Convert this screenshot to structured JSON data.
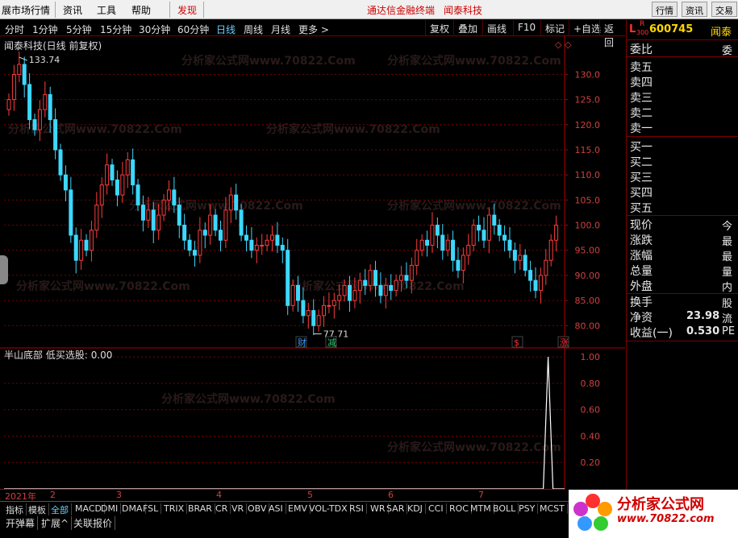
{
  "menubar": {
    "items": [
      {
        "label": "展市场行情",
        "color": "#000"
      },
      {
        "label": "资讯",
        "color": "#000"
      },
      {
        "label": "工具",
        "color": "#000"
      },
      {
        "label": "帮助",
        "color": "#000"
      },
      {
        "label": "发现",
        "color": "#d00000"
      }
    ],
    "center_brand": "通达信金融终端",
    "center_stock": "闻泰科技",
    "right_buttons": [
      "行情",
      "资讯",
      "交易"
    ]
  },
  "toolbar": {
    "periods": [
      "分时",
      "1分钟",
      "5分钟",
      "15分钟",
      "30分钟",
      "60分钟",
      "日线",
      "周线",
      "月线",
      "更多 >"
    ],
    "active_period": "日线",
    "buttons": [
      "复权",
      "叠加",
      "画线",
      "F10",
      "标记",
      "+自选",
      "返回"
    ]
  },
  "chart": {
    "title": "闻泰科技(日线 前复权)",
    "high_label": "133.74",
    "low_label": "77.71",
    "indicator_title": "半山底部",
    "indicator_value_label": "低买选股:",
    "indicator_value": "0.00",
    "markers": [
      {
        "text": "财",
        "color": "#3aa0ff"
      },
      {
        "text": "减",
        "color": "#2ecc71"
      },
      {
        "text": "$",
        "color": "#ff3030"
      },
      {
        "text": "涨",
        "color": "#ff3030"
      }
    ],
    "watermark": "分析家公式网www.70822.Com"
  },
  "chart_data": {
    "type": "candlestick",
    "ylim": [
      77,
      136
    ],
    "price_ticks": [
      "130.0",
      "125.0",
      "120.0",
      "115.0",
      "110.0",
      "105.0",
      "100.0",
      "95.00",
      "90.00",
      "85.00",
      "80.00"
    ],
    "price_tick_values": [
      130,
      125,
      120,
      115,
      110,
      105,
      100,
      95,
      90,
      85,
      80
    ],
    "indicator_ticks": [
      "1.00",
      "0.80",
      "0.60",
      "0.40",
      "0.20"
    ],
    "indicator_tick_values": [
      1.0,
      0.8,
      0.6,
      0.4,
      0.2
    ],
    "indicator_ylim": [
      0,
      1.05
    ],
    "indicator_spike_at": 131,
    "x_labels": [
      "2021年",
      "2",
      "3",
      "4",
      "5",
      "6",
      "7"
    ],
    "x_label_index": [
      0,
      8,
      20,
      37,
      50,
      64,
      78
    ],
    "closes": [
      125,
      130,
      132,
      128,
      121,
      119,
      123,
      126,
      121,
      115,
      110,
      107,
      98,
      93,
      97,
      95,
      99,
      104,
      108,
      112,
      109,
      106,
      110,
      113,
      108,
      104,
      101,
      103,
      99,
      102,
      105,
      107,
      104,
      100,
      97,
      95,
      94,
      99,
      98,
      102,
      99,
      97,
      103,
      106,
      103,
      98,
      97,
      95,
      96,
      96,
      97,
      98,
      96,
      95,
      84,
      88,
      85,
      82,
      83,
      80,
      82,
      84,
      84,
      85,
      86,
      88,
      85,
      87,
      89,
      88,
      91,
      88,
      86,
      88,
      87,
      89,
      90,
      89,
      92,
      95,
      97,
      96,
      100,
      98,
      95,
      97,
      93,
      91,
      94,
      96,
      100,
      99,
      97,
      102,
      100,
      98,
      97,
      95,
      93,
      94,
      91,
      89,
      87,
      90,
      93,
      97,
      100
    ]
  },
  "rpanel": {
    "stock_code": "600745",
    "stock_name": "闻泰",
    "l_mark": "L",
    "r_mark": "R",
    "r_sub": "300",
    "weibi": "委比",
    "weibi_r": "委",
    "sell": [
      "卖五",
      "卖四",
      "卖三",
      "卖二",
      "卖一"
    ],
    "buy": [
      "买一",
      "买二",
      "买三",
      "买四",
      "买五"
    ],
    "stats": [
      {
        "label": "现价",
        "right": "今"
      },
      {
        "label": "涨跌",
        "right": "最"
      },
      {
        "label": "涨幅",
        "right": "最"
      },
      {
        "label": "总量",
        "right": "量"
      },
      {
        "label": "外盘",
        "right": "内"
      },
      {
        "label": "换手",
        "right": "股"
      },
      {
        "label": "净资",
        "value": "23.98",
        "right": "流"
      },
      {
        "label": "收益(一)",
        "value": "0.530",
        "right": "PE"
      }
    ]
  },
  "bottom": {
    "indicator_tabs": [
      "指标",
      "模板",
      "全部",
      "MACD",
      "DMI",
      "DMA",
      "FSL",
      "TRIX",
      "BRAR",
      "CR",
      "VR",
      "OBV",
      "ASI",
      "EMV",
      "VOL-TDX",
      "RSI",
      "WR",
      "SAR",
      "KDJ",
      "CCI",
      "ROC",
      "MTM",
      "BOLL",
      "PSY",
      "MCST"
    ],
    "active_tab": "全部",
    "bottom_tabs": [
      "开弹幕",
      "扩展^",
      "关联报价"
    ],
    "logo_title": "分析家公式网",
    "logo_url": "www.70822.com"
  },
  "colors": {
    "up": "#ff3c3c",
    "down": "#3cd8ff",
    "grid": "#7a0000",
    "axis": "#b00000"
  }
}
